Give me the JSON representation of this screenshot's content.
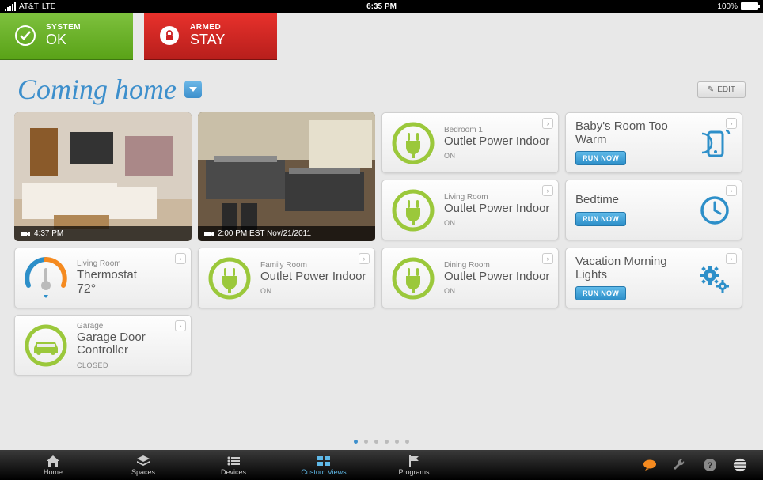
{
  "status": {
    "carrier": "AT&T",
    "network": "LTE",
    "time": "6:35 PM",
    "battery": "100%"
  },
  "topTiles": {
    "system": {
      "label": "SYSTEM",
      "value": "OK"
    },
    "armed": {
      "label": "ARMED",
      "value": "STAY"
    }
  },
  "title": "Coming home",
  "editLabel": "EDIT",
  "cameras": [
    {
      "timestamp": "4:37 PM"
    },
    {
      "timestamp": "2:00 PM EST Nov/21/2011"
    }
  ],
  "col3": [
    {
      "room": "Bedroom 1",
      "name": "Outlet Power Indoor",
      "state": "ON"
    },
    {
      "room": "Living Room",
      "name": "Outlet Power Indoor",
      "state": "ON"
    },
    {
      "room": "Dining Room",
      "name": "Outlet Power Indoor",
      "state": "ON"
    }
  ],
  "programs": [
    {
      "name": "Baby's Room Too Warm",
      "btn": "RUN NOW"
    },
    {
      "name": "Bedtime",
      "btn": "RUN NOW"
    },
    {
      "name": "Vacation Morning Lights",
      "btn": "RUN NOW"
    }
  ],
  "thermo": {
    "room": "Living Room",
    "name": "Thermostat",
    "value": "72°"
  },
  "familyOutlet": {
    "room": "Family Room",
    "name": "Outlet Power Indoor",
    "state": "ON"
  },
  "garage": {
    "room": "Garage",
    "name": "Garage Door Controller",
    "state": "CLOSED"
  },
  "nav": {
    "home": "Home",
    "spaces": "Spaces",
    "devices": "Devices",
    "custom": "Custom Views",
    "programs": "Programs"
  }
}
